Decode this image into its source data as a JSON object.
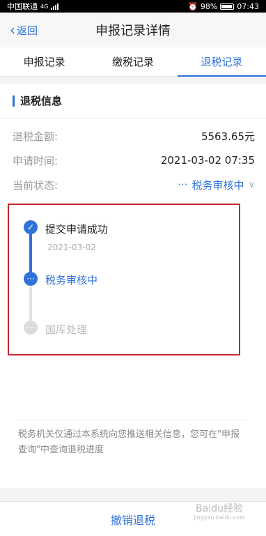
{
  "status_bar": {
    "carrier": "中国联通",
    "network": "4G",
    "alarm_icon": "alarm-icon",
    "battery": "98%",
    "time": "07:43"
  },
  "navbar": {
    "back_label": "返回",
    "title": "申报记录详情"
  },
  "tabs": [
    {
      "label": "申报记录",
      "active": false
    },
    {
      "label": "缴税记录",
      "active": false
    },
    {
      "label": "退税记录",
      "active": true
    }
  ],
  "refund_info": {
    "section_title": "退税信息",
    "rows": [
      {
        "label": "退税金额:",
        "value": "5563.65元"
      },
      {
        "label": "申请时间:",
        "value": "2021-03-02 07:35"
      },
      {
        "label": "当前状态:",
        "value": "税务审核中",
        "prefix": "···"
      }
    ]
  },
  "timeline": [
    {
      "label": "提交申请成功",
      "date": "2021-03-02",
      "state": "done"
    },
    {
      "label": "税务审核中",
      "state": "current",
      "marker": "···"
    },
    {
      "label": "国库处理",
      "state": "pending",
      "marker": "···"
    }
  ],
  "note": "税务机关仅通过本系统向您推送相关信息，您可在\"申报查询\"中查询退税进度",
  "bottom_button": "撤销退税",
  "watermark": {
    "main": "Baidu经验",
    "sub": "jingyan.baidu.com"
  },
  "colors": {
    "accent": "#2f73d9",
    "highlight_border": "#c6262e"
  }
}
